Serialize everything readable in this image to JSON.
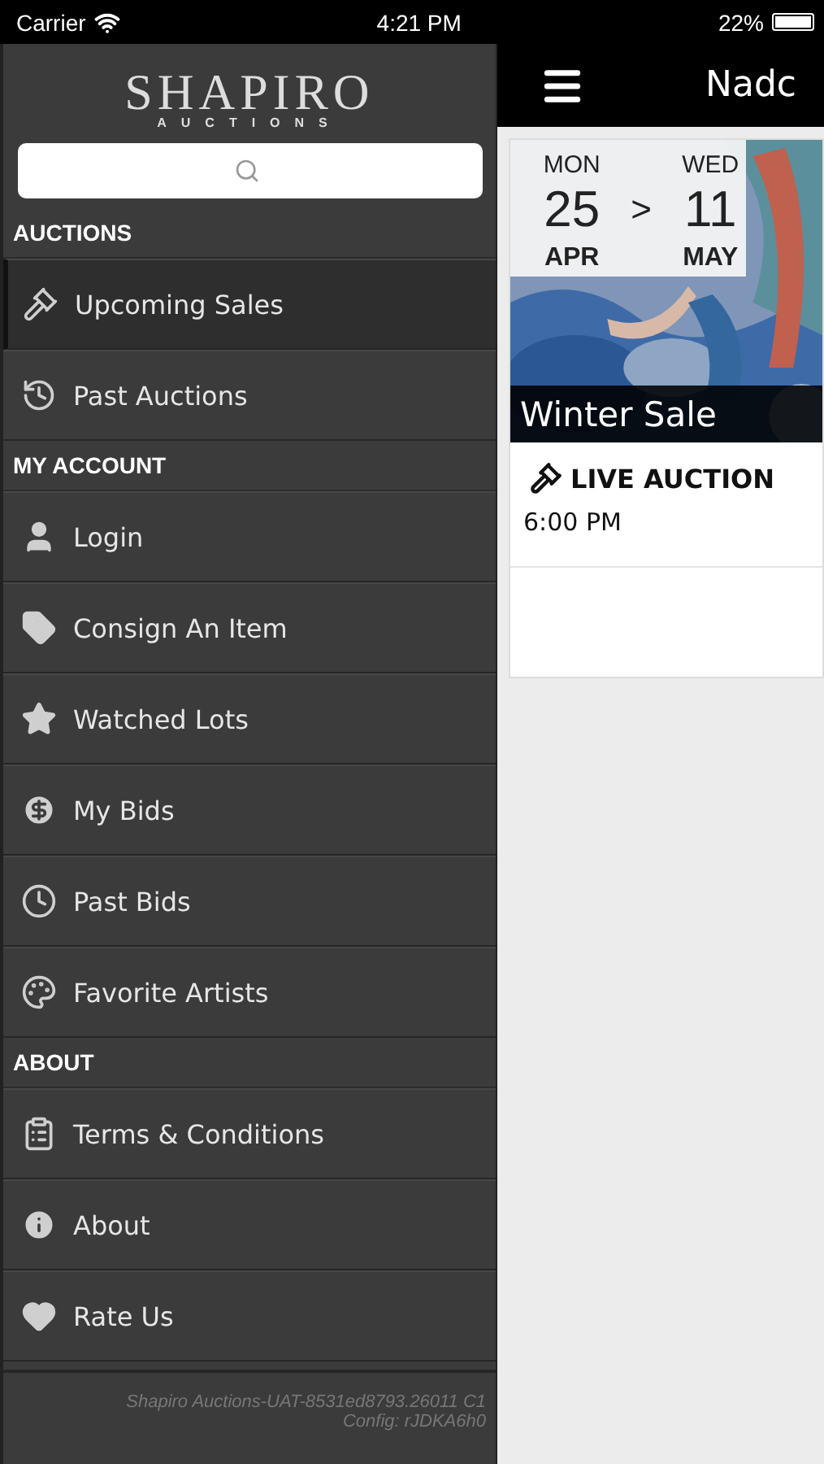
{
  "status_bar": {
    "carrier": "Carrier",
    "time": "4:21 PM",
    "battery": "22%"
  },
  "sidebar": {
    "logo": {
      "name": "SHAPIRO",
      "tagline": "AUCTIONS"
    },
    "sections": [
      {
        "title": "AUCTIONS",
        "items": [
          {
            "label": "Upcoming Sales",
            "selected": true
          },
          {
            "label": "Past Auctions",
            "selected": false
          }
        ]
      },
      {
        "title": "MY ACCOUNT",
        "items": [
          {
            "label": "Login",
            "selected": false
          },
          {
            "label": "Consign An Item",
            "selected": false
          },
          {
            "label": "Watched Lots",
            "selected": false
          },
          {
            "label": "My Bids",
            "selected": false
          },
          {
            "label": "Past Bids",
            "selected": false
          },
          {
            "label": "Favorite Artists",
            "selected": false
          }
        ]
      },
      {
        "title": "ABOUT",
        "items": [
          {
            "label": "Terms & Conditions",
            "selected": false
          },
          {
            "label": "About",
            "selected": false
          },
          {
            "label": "Rate Us",
            "selected": false
          }
        ]
      }
    ],
    "footer": [
      "Shapiro Auctions-UAT-8531ed8793.26011 C1",
      "Config: rJDKA6h0"
    ]
  },
  "header": {
    "title": "Nadc"
  },
  "sale": {
    "start": {
      "weekday": "MON",
      "day": "25",
      "month": "APR"
    },
    "separator": ">",
    "end": {
      "weekday": "WED",
      "day": "11",
      "month": "MAY"
    },
    "title": "Winter Sale",
    "type": "LIVE AUCTION",
    "time": "6:00 PM"
  }
}
